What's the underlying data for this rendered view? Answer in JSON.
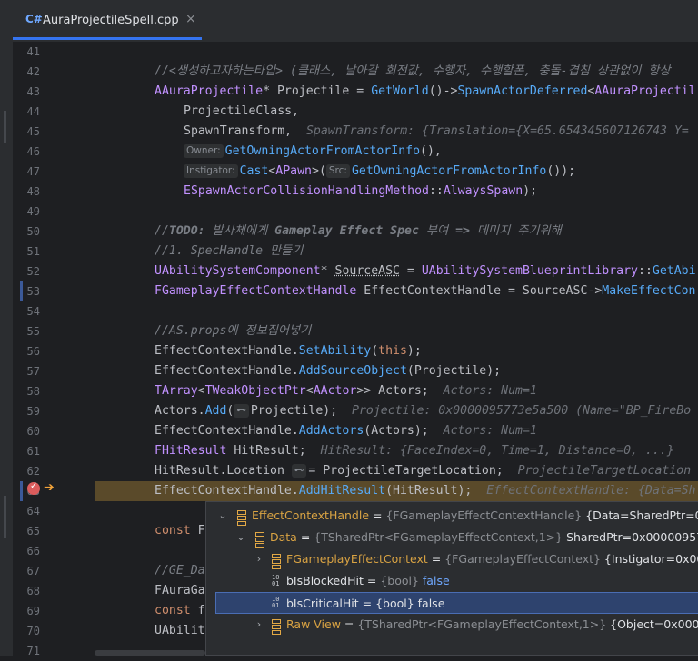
{
  "tab": {
    "icon": "C#",
    "file_name": "AuraProjectileSpell.cpp",
    "close": "×"
  },
  "line_numbers": [
    "41",
    "42",
    "43",
    "44",
    "45",
    "46",
    "47",
    "48",
    "49",
    "50",
    "51",
    "52",
    "53",
    "54",
    "55",
    "56",
    "57",
    "58",
    "59",
    "60",
    "61",
    "62",
    "63",
    "64",
    "65",
    "66",
    "67",
    "68",
    "69",
    "70",
    "71"
  ],
  "code": {
    "l42": "//<생성하고자하는타입> (클래스, 날아갈 회전값, 수행자, 수행할폰, 충돌-겹침 상관없이 항상",
    "l43": [
      "AAuraProjectile",
      "* Projectile = ",
      "GetWorld",
      "()->",
      "SpawnActorDeferred",
      "<",
      "AAuraProjectil"
    ],
    "l44": "ProjectileClass,",
    "l45": [
      "SpawnTransform,",
      "SpawnTransform: {Translation={X=65.654345607126743 Y="
    ],
    "l46": [
      "Owner:",
      "GetOwningActorFromActorInfo",
      "(),"
    ],
    "l47": [
      "Instigator:",
      "Cast",
      "<",
      "APawn",
      ">(",
      "Src:",
      "GetOwningActorFromActorInfo",
      "());"
    ],
    "l48": [
      "ESpawnActorCollisionHandlingMethod",
      "::",
      "AlwaysSpawn",
      ");"
    ],
    "l50": [
      "//",
      "TODO:",
      " 발사체에게 ",
      "Gameplay Effect Spec",
      " 부여 ",
      "=>",
      " 데미지 주기위해"
    ],
    "l51": "//1. SpecHandle 만들기",
    "l52": [
      "UAbilitySystemComponent",
      "* ",
      "SourceASC",
      " = ",
      "UAbilitySystemBlueprintLibrary",
      "::",
      "GetAbi"
    ],
    "l53": [
      "FGameplayEffectContextHandle",
      " EffectContextHandle = SourceASC->",
      "MakeEffectCon"
    ],
    "l55": "//AS.props에 정보집어넣기",
    "l56": [
      "EffectContextHandle.",
      "SetAbility",
      "(",
      "this",
      ");"
    ],
    "l57": [
      "EffectContextHandle.",
      "AddSourceObject",
      "(Projectile);"
    ],
    "l58": [
      "TArray",
      "<",
      "TWeakObjectPtr",
      "<",
      "AActor",
      ">> Actors;",
      "Actors: Num=1"
    ],
    "l59": [
      "Actors.",
      "Add",
      "(",
      "Projectile);",
      "Projectile: 0x0000095773e5a500 (Name=\"BP_FireBo"
    ],
    "l60": [
      "EffectContextHandle.",
      "AddActors",
      "(Actors);",
      "Actors: Num=1"
    ],
    "l61": [
      "FHitResult",
      " HitResult;",
      "HitResult: {FaceIndex=0, Time=1, Distance=0, ...}"
    ],
    "l62": [
      "HitResult.Location ",
      "= ProjectileTargetLocation;",
      "ProjectileTargetLocation"
    ],
    "l63": [
      "EffectContextHandle.",
      "AddHitResult",
      "(HitResult);",
      "EffectContextHandle: {Data=Sh"
    ],
    "l65": [
      "const",
      " F"
    ],
    "l67": "//GE_Da",
    "l68": "FAuraGa",
    "l69": [
      "const",
      " f"
    ],
    "l70": "UAbilit"
  },
  "debugger_popup": {
    "rows": [
      {
        "chevron": "⌄",
        "name": "EffectContextHandle",
        "eq": " = ",
        "type": "{FGameplayEffectContextHandle}",
        "value": " {Data=SharedPtr=0x0"
      },
      {
        "chevron": "⌄",
        "name": "Data",
        "eq": " = ",
        "type": "{TSharedPtr<FGameplayEffectContext,1>}",
        "value": " SharedPtr=0x00000957b"
      },
      {
        "chevron": "›",
        "name": "FGameplayEffectContext",
        "eq": " = ",
        "type": "{FGameplayEffectContext}",
        "value": " {Instigator=0x000"
      },
      {
        "name": "bIsBlockedHit",
        "eq": " = ",
        "type": "{bool}",
        "value": " false"
      },
      {
        "name": "bIsCriticalHit",
        "eq": " = ",
        "type": "{bool}",
        "value": " false"
      },
      {
        "chevron": "›",
        "name": "Raw View",
        "eq": " = ",
        "type": "{TSharedPtr<FGameplayEffectContext,1>}",
        "value": " {Object=0x00000"
      }
    ]
  },
  "colors": {
    "exec_line": "#5a4a2a",
    "breakpoint": "#db5c5c",
    "selection": "#2e436e"
  }
}
